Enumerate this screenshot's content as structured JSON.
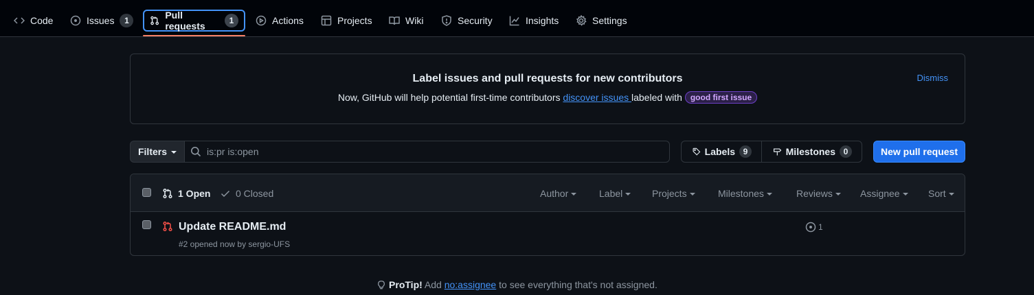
{
  "nav": {
    "code": "Code",
    "issues": "Issues",
    "issues_count": "1",
    "pulls": "Pull requests",
    "pulls_count": "1",
    "actions": "Actions",
    "projects": "Projects",
    "wiki": "Wiki",
    "security": "Security",
    "insights": "Insights",
    "settings": "Settings"
  },
  "banner": {
    "title": "Label issues and pull requests for new contributors",
    "text_before": "Now, GitHub will help potential first-time contributors ",
    "link": "discover issues ",
    "text_after": " labeled with ",
    "label": "good first issue",
    "dismiss": "Dismiss"
  },
  "toolbar": {
    "filters": "Filters",
    "search_value": "is:pr is:open",
    "labels": "Labels",
    "labels_count": "9",
    "milestones": "Milestones",
    "milestones_count": "0",
    "new_pr": "New pull request"
  },
  "list": {
    "open": "1 Open",
    "closed": "0 Closed",
    "filters": [
      "Author",
      "Label",
      "Projects",
      "Milestones",
      "Reviews",
      "Assignee",
      "Sort"
    ],
    "rows": [
      {
        "title": "Update README.md",
        "meta": "#2 opened now by sergio-UFS",
        "linked_count": "1"
      }
    ]
  },
  "protip": {
    "label": "ProTip!",
    "before": " Add ",
    "link": "no:assignee",
    "after": " to see everything that's not assigned."
  },
  "colors": {
    "accent": "#4493f8",
    "primary_button": "#1f6feb",
    "selected_underline": "#f78166",
    "pr_icon": "#f85149"
  }
}
